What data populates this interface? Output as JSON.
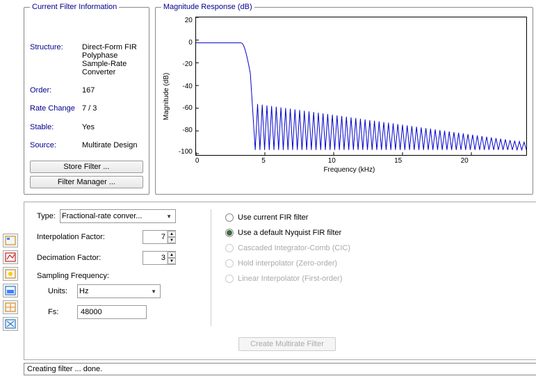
{
  "filter_info": {
    "title": "Current Filter Information",
    "rows": [
      {
        "label": "Structure:",
        "value": "Direct-Form FIR Polyphase Sample-Rate Converter"
      },
      {
        "label": "Order:",
        "value": "167"
      },
      {
        "label": "Rate Change",
        "value": "7 / 3"
      },
      {
        "label": "Stable:",
        "value": "Yes"
      },
      {
        "label": "Source:",
        "value": "Multirate Design"
      }
    ],
    "store_btn": "Store Filter ...",
    "manager_btn": "Filter Manager ..."
  },
  "mag_response": {
    "title": "Magnitude Response (dB)",
    "ylabel": "Magnitude (dB)",
    "xlabel": "Frequency (kHz)",
    "yticks": [
      "20",
      "0",
      "-20",
      "-40",
      "-60",
      "-80",
      "-100"
    ],
    "xticks": [
      "0",
      "5",
      "10",
      "15",
      "20"
    ]
  },
  "chart_data": {
    "type": "line",
    "title": "Magnitude Response (dB)",
    "xlabel": "Frequency (kHz)",
    "ylabel": "Magnitude (dB)",
    "xlim": [
      0,
      24
    ],
    "ylim": [
      -110,
      25
    ],
    "description": "FIR lowpass magnitude response. Passband flat near 0 dB from 0 to ~3.4 kHz, sharp transition band, stopband oscillating between approximately -60 dB and -105 dB from ~4.3 kHz to 24 kHz with ripple lobes.",
    "passband_db": 0,
    "stopband_start_khz": 4.3,
    "stopband_peak_db": -60,
    "stopband_min_db": -105,
    "cutoff_khz": 3.43
  },
  "type_control": {
    "label": "Type:",
    "value": "Fractional-rate conver..."
  },
  "interp": {
    "label": "Interpolation Factor:",
    "value": "7"
  },
  "decim": {
    "label": "Decimation Factor:",
    "value": "3"
  },
  "sampling": {
    "header": "Sampling Frequency:",
    "units_label": "Units:",
    "units_value": "Hz",
    "fs_label": "Fs:",
    "fs_value": "48000"
  },
  "radios": {
    "r1": "Use current FIR filter",
    "r2": "Use a default Nyquist FIR filter",
    "r3": "Cascaded Integrator-Comb (CIC)",
    "r4": "Hold interpolator (Zero-order)",
    "r5": "Linear Interpolator (First-order)"
  },
  "create_btn": "Create Multirate Filter",
  "status_text": "Creating filter ... done."
}
